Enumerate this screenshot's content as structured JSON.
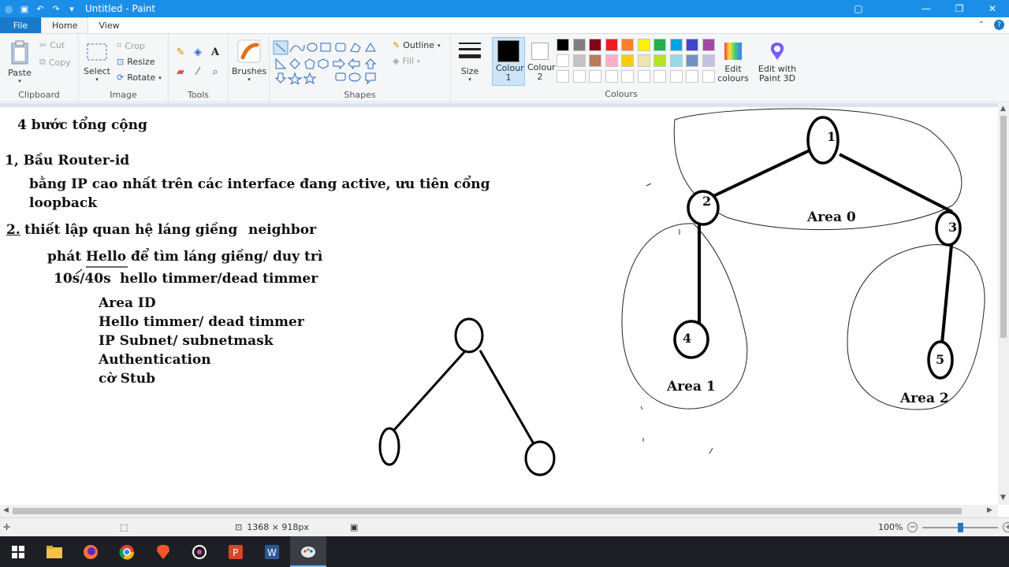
{
  "window": {
    "title": "Untitled - Paint"
  },
  "menu": {
    "file": "File",
    "home": "Home",
    "view": "View"
  },
  "ribbon": {
    "clipboard": {
      "label": "Clipboard",
      "paste": "Paste",
      "cut": "Cut",
      "copy": "Copy"
    },
    "image": {
      "label": "Image",
      "select": "Select",
      "crop": "Crop",
      "resize": "Resize",
      "rotate": "Rotate"
    },
    "tools": {
      "label": "Tools"
    },
    "brushes": "Brushes",
    "shapes": {
      "label": "Shapes",
      "outline": "Outline",
      "fill": "Fill"
    },
    "size": "Size",
    "colour1": "Colour 1",
    "colour2": "Colour 2",
    "colours": {
      "label": "Colours",
      "edit_colours": "Edit colours",
      "edit_paint3d": "Edit with Paint 3D"
    },
    "palette": [
      "#000000",
      "#7f7f7f",
      "#880015",
      "#ed1c24",
      "#ff7f27",
      "#fff200",
      "#22b14c",
      "#00a2e8",
      "#3f48cc",
      "#a349a4",
      "#ffffff",
      "#c3c3c3",
      "#b97a57",
      "#ffaec9",
      "#ffc90e",
      "#efe4b0",
      "#b5e61d",
      "#99d9ea",
      "#7092be",
      "#c8bfe7"
    ]
  },
  "canvas_text": {
    "heading": "4 bước tổng cộng",
    "step1": "1, Bầu Router-id",
    "step1_desc1": "bằng IP cao nhất trên các interface đang active, ưu tiên cổng",
    "step1_desc2": "loopback",
    "step2_num": "2.",
    "step2": "thiết lập quan hệ láng giềng",
    "step2_neighbor": "neighbor",
    "hello_line_a": "phát",
    "hello_line_b": "Hello",
    "hello_line_c": "để tìm láng giềng/ duy trì",
    "timer_line_a": "10s/40s",
    "timer_line_b": "hello timmer/dead timmer",
    "items": [
      "Area ID",
      "Hello timmer/ dead timmer",
      "IP Subnet/ subnetmask",
      "Authentication",
      "cờ Stub"
    ]
  },
  "diagram": {
    "nodes": [
      "1",
      "2",
      "3",
      "4",
      "5"
    ],
    "areas": [
      "Area 0",
      "Area 1",
      "Area 2"
    ]
  },
  "status": {
    "dimensions": "1368 × 918px",
    "zoom": "100%"
  }
}
